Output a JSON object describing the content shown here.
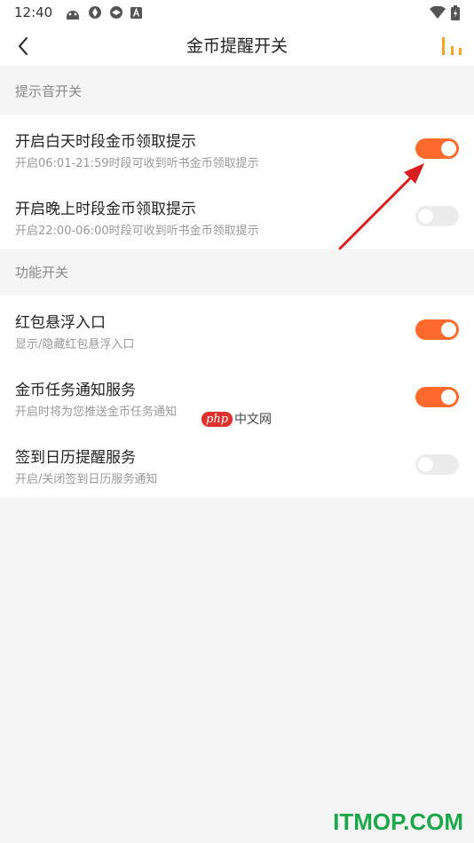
{
  "status_bar": {
    "time": "12:40",
    "battery_glyph": "+"
  },
  "nav": {
    "title": "金币提醒开关"
  },
  "sections": [
    {
      "header": "提示音开关",
      "items": [
        {
          "title": "开启白天时段金币领取提示",
          "desc": "开启06:01-21:59时段可收到听书金币领取提示",
          "on": true
        },
        {
          "title": "开启晚上时段金币领取提示",
          "desc": "开启22:00-06:00时段可收到听书金币领取提示",
          "on": false
        }
      ]
    },
    {
      "header": "功能开关",
      "items": [
        {
          "title": "红包悬浮入口",
          "desc": "显示/隐藏红包悬浮入口",
          "on": true
        },
        {
          "title": "金币任务通知服务",
          "desc": "开启时将为您推送金币任务通知",
          "on": true
        },
        {
          "title": "签到日历提醒服务",
          "desc": "开启/关闭签到日历服务通知",
          "on": false
        }
      ]
    }
  ],
  "colors": {
    "accent": "#fe6a2c",
    "toggle_off": "#ececec",
    "stats_icon": "#f5a623",
    "annotation_arrow": "#d81e1e"
  },
  "watermarks": {
    "php_badge": "php",
    "php_text": "中文网",
    "site": "ITMOP.COM"
  }
}
